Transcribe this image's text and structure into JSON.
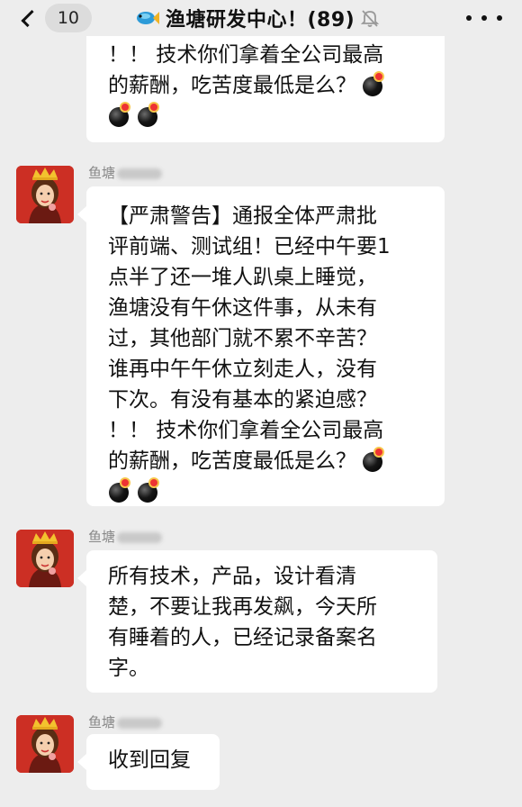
{
  "header": {
    "back_count": "10",
    "title": "渔塘研发中心！(89)",
    "icons": {
      "back": "chevron-left-icon",
      "group": "fish-icon",
      "mute": "bell-off-icon",
      "more": "more-horizontal-icon"
    }
  },
  "messages": [
    {
      "sender": "",
      "lines": [
        "！！ 技术你们拿着全公司最高",
        "的薪酬，吃苦度最低是么？"
      ],
      "emoji": "bomb-emoji"
    },
    {
      "sender": "鱼塘",
      "lines": [
        "【严肃警告】通报全体严肃批",
        "评前端、测试组！已经中午要1",
        "点半了还一堆人趴桌上睡觉，",
        "渔塘没有午休这件事，从未有",
        "过，其他部门就不累不辛苦？",
        "谁再中午午休立刻走人，没有",
        "下次。有没有基本的紧迫感？",
        "！！ 技术你们拿着全公司最高",
        "的薪酬，吃苦度最低是么？"
      ],
      "emoji": "bomb-emoji"
    },
    {
      "sender": "鱼塘",
      "lines": [
        "所有技术，产品，设计看清",
        "楚，不要让我再发飙，今天所",
        "有睡着的人，已经记录备案名",
        "字。"
      ]
    },
    {
      "sender": "鱼塘",
      "lines": [
        "收到回复"
      ]
    }
  ],
  "colors": {
    "background": "#ededed",
    "bubble": "#ffffff",
    "avatar_bg": "#cc2f24",
    "name_text": "#888888"
  }
}
